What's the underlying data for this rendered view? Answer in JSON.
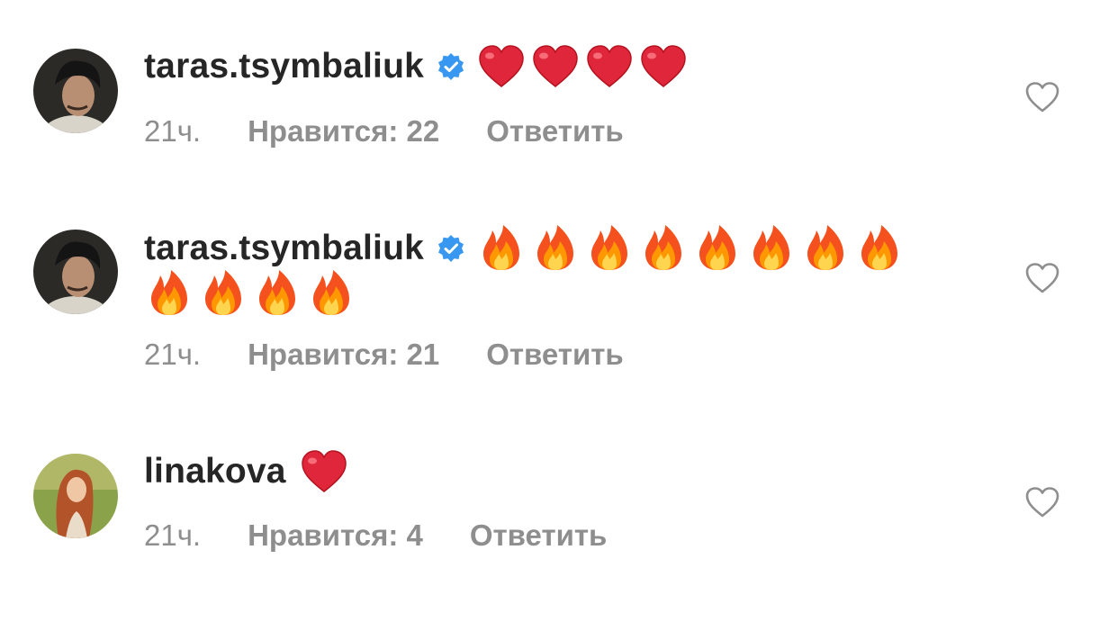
{
  "comments": [
    {
      "username": "taras.tsymbaliuk",
      "verified": true,
      "avatar": "dark-haired-man-avatar",
      "emojis_line1": [
        "red-heart",
        "red-heart",
        "red-heart",
        "red-heart"
      ],
      "emojis_line2": [],
      "time": "21ч.",
      "likes": "Нравится: 22",
      "reply": "Ответить"
    },
    {
      "username": "taras.tsymbaliuk",
      "verified": true,
      "avatar": "dark-haired-man-avatar",
      "emojis_line1": [
        "fire",
        "fire",
        "fire",
        "fire",
        "fire",
        "fire",
        "fire",
        "fire"
      ],
      "emojis_line2": [
        "fire",
        "fire",
        "fire",
        "fire"
      ],
      "time": "21ч.",
      "likes": "Нравится: 21",
      "reply": "Ответить"
    },
    {
      "username": "linakova",
      "verified": false,
      "avatar": "red-haired-woman-avatar",
      "emojis_line1": [
        "red-heart"
      ],
      "emojis_line2": [],
      "time": "21ч.",
      "likes": "Нравится: 4",
      "reply": "Ответить"
    }
  ],
  "colors": {
    "text": "#262626",
    "secondary": "#8e8e8e",
    "verified": "#3897f0",
    "heart": "#e0263a",
    "like_outline": "#8e8e8e"
  }
}
